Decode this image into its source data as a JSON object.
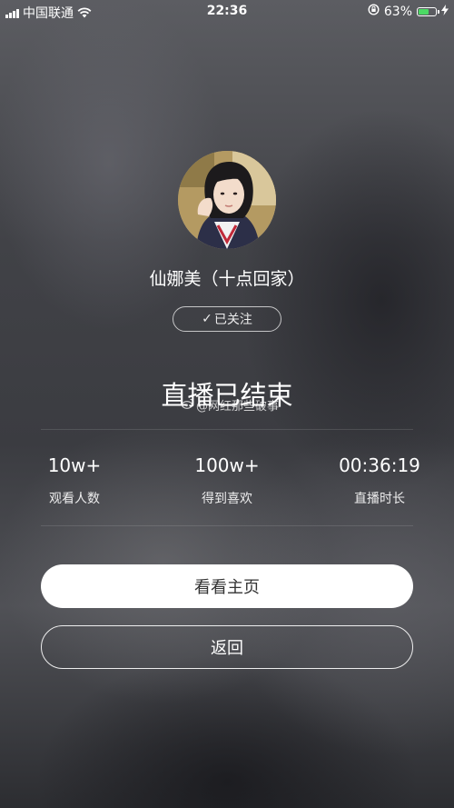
{
  "status_bar": {
    "carrier": "中国联通",
    "time": "22:36",
    "battery_percent": "63%",
    "battery_level": 0.63,
    "icons": [
      "signal-icon",
      "wifi-icon",
      "orientation-lock-icon",
      "battery-icon",
      "charging-icon"
    ]
  },
  "profile": {
    "name": "仙娜美（十点回家）",
    "follow_label": "已关注",
    "follow_check_glyph": "✓"
  },
  "live": {
    "ended_title": "直播已结束",
    "watermark": "@网红那些破事"
  },
  "stats": [
    {
      "value": "10w+",
      "label": "观看人数"
    },
    {
      "value": "100w+",
      "label": "得到喜欢"
    },
    {
      "value": "00:36:19",
      "label": "直播时长"
    }
  ],
  "actions": {
    "view_homepage": "看看主页",
    "back": "返回"
  },
  "colors": {
    "battery_green": "#4cd964",
    "primary_button_bg": "#ffffff",
    "primary_button_text": "#333333"
  }
}
